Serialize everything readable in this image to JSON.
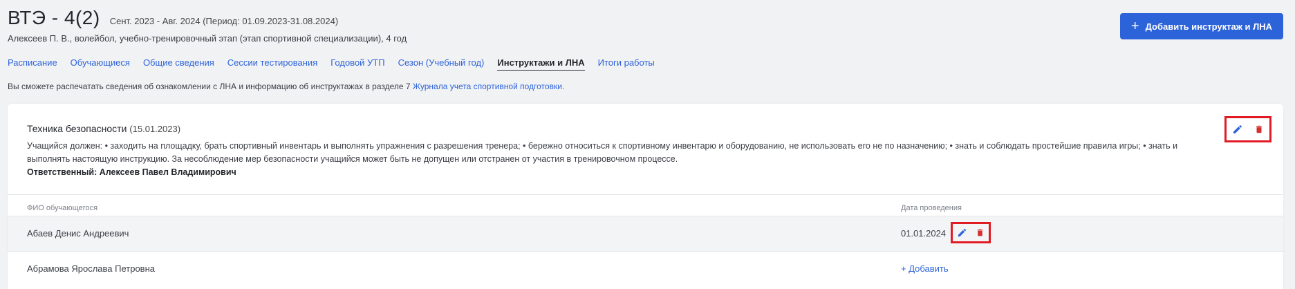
{
  "header": {
    "title": "ВТЭ - 4(2)",
    "period": "Сент. 2023 - Авг. 2024 (Период: 01.09.2023-31.08.2024)",
    "subtitle": "Алексеев П. В., волейбол, учебно-тренировочный этап (этап спортивной специализации), 4 год"
  },
  "add_button": {
    "icon": "+",
    "label": "Добавить инструктаж и ЛНА"
  },
  "tabs": [
    {
      "label": "Расписание",
      "active": false
    },
    {
      "label": "Обучающиеся",
      "active": false
    },
    {
      "label": "Общие сведения",
      "active": false
    },
    {
      "label": "Сессии тестирования",
      "active": false
    },
    {
      "label": "Годовой УТП",
      "active": false
    },
    {
      "label": "Сезон (Учебный год)",
      "active": false
    },
    {
      "label": "Инструктажи и ЛНА",
      "active": true
    },
    {
      "label": "Итоги работы",
      "active": false
    }
  ],
  "info": {
    "text": "Вы сможете распечатать сведения об ознакомлении с ЛНА и информацию об инструктажах в разделе 7 ",
    "link": "Журнала учета спортивной подготовки."
  },
  "card": {
    "title": "Техника безопасности",
    "date": "(15.01.2023)",
    "description": "Учащийся должен: • заходить на площадку, брать спортивный инвентарь и выполнять упражнения с разрешения тренера; • бережно относиться к спортивному инвентарю и оборудованию, не использовать его не по назначению; • знать и соблюдать простейшие правила игры; • знать и выполнять настоящую инструкцию. За несоблюдение мер безопасности учащийся может быть не допущен или отстранен от участия в тренировочном процессе.",
    "responsible": "Ответственный: Алексеев Павел Владимирович"
  },
  "table": {
    "col_name": "ФИО обучающегося",
    "col_date": "Дата проведения",
    "rows": [
      {
        "name": "Абаев Денис Андреевич",
        "date": "01.01.2024"
      },
      {
        "name": "Абрамова Ярослава Петровна",
        "add_label": "+ Добавить"
      }
    ]
  },
  "icons": {
    "edit": "pencil-icon",
    "delete": "trash-icon"
  },
  "colors": {
    "accent": "#2d63d8",
    "delete": "#d32f2f",
    "highlight": "#e01b24"
  }
}
